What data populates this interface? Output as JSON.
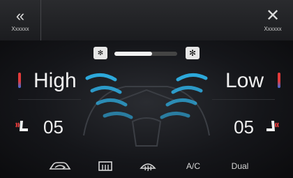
{
  "header": {
    "back_label": "Xxxxxx",
    "close_label": "Xxxxxx"
  },
  "fan": {
    "level": 0.6
  },
  "temperature": {
    "left": "High",
    "right": "Low"
  },
  "seat_heat": {
    "left": "05",
    "right": "05"
  },
  "bottom_controls": {
    "ac_label": "A/C",
    "dual_label": "Dual"
  },
  "colors": {
    "accent_blue": "#2fb8f0",
    "hot_red": "#e23b3b",
    "cold_blue": "#3a6fe2"
  }
}
